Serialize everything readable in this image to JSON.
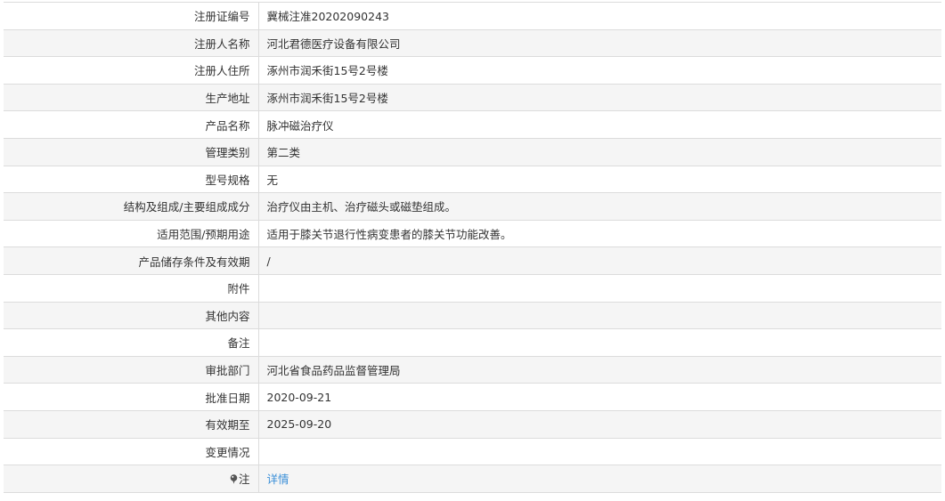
{
  "rows": [
    {
      "label": "注册证编号",
      "value": "冀械注准20202090243"
    },
    {
      "label": "注册人名称",
      "value": "河北君德医疗设备有限公司"
    },
    {
      "label": "注册人住所",
      "value": "涿州市润禾街15号2号楼"
    },
    {
      "label": "生产地址",
      "value": "涿州市润禾街15号2号楼"
    },
    {
      "label": "产品名称",
      "value": "脉冲磁治疗仪"
    },
    {
      "label": "管理类别",
      "value": "第二类"
    },
    {
      "label": "型号规格",
      "value": "无"
    },
    {
      "label": "结构及组成/主要组成成分",
      "value": "治疗仪由主机、治疗磁头或磁垫组成。"
    },
    {
      "label": "适用范围/预期用途",
      "value": "适用于膝关节退行性病变患者的膝关节功能改善。"
    },
    {
      "label": "产品储存条件及有效期",
      "value": "/"
    },
    {
      "label": "附件",
      "value": ""
    },
    {
      "label": "其他内容",
      "value": ""
    },
    {
      "label": "备注",
      "value": ""
    },
    {
      "label": "审批部门",
      "value": "河北省食品药品监督管理局"
    },
    {
      "label": "批准日期",
      "value": "2020-09-21"
    },
    {
      "label": "有效期至",
      "value": "2025-09-20"
    },
    {
      "label": "变更情况",
      "value": ""
    }
  ],
  "note": {
    "label": "注",
    "icon": "pin-icon",
    "link_text": "详情"
  },
  "colors": {
    "link": "#3a8fd8",
    "stripe": "#f5f5f5",
    "border": "#dcdcdc"
  }
}
